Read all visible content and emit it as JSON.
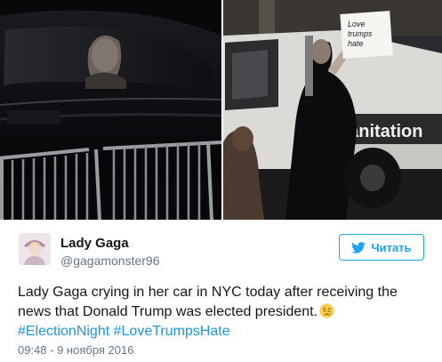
{
  "tweet": {
    "author": {
      "display_name": "Lady Gaga",
      "screen_name": "@gagamonster96",
      "avatar_icon": "user-avatar"
    },
    "follow_button": {
      "label": "Читать",
      "icon": "twitter-bird-icon",
      "color": "#1da1f2"
    },
    "text": "Lady Gaga crying in her car in NYC today after receiving the news that Donald Trump was elected president.",
    "emoji_icon": "disappointed-relieved-face-icon",
    "hashtags": [
      "#ElectionNight",
      "#LoveTrumpsHate"
    ],
    "hashtag_color": "#1b95e0",
    "timestamp": "09:48 - 9 ноября 2016",
    "photos": {
      "right_sign_text": [
        "Love",
        "trumps",
        "hate"
      ],
      "truck_text": "sanitation"
    }
  }
}
